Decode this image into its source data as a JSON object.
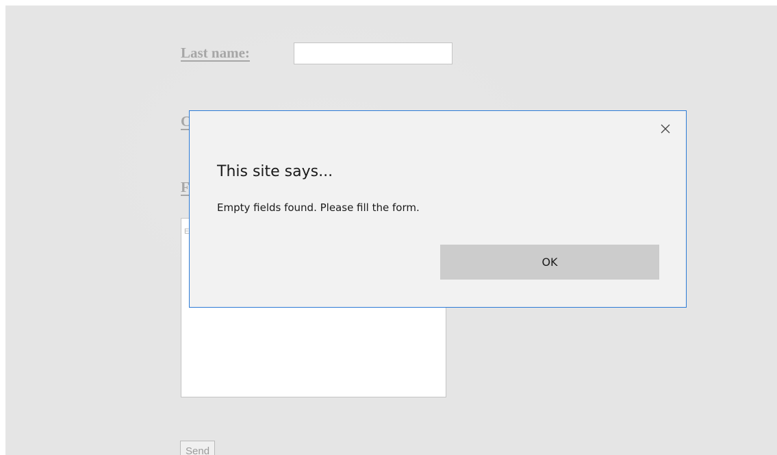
{
  "form": {
    "last_name_label": "Last name:",
    "second_label_partial": "C",
    "third_label_partial": "F",
    "textarea_placeholder": "E",
    "send_label": "Send"
  },
  "dialog": {
    "title": "This site says...",
    "message": "Empty fields found. Please fill the form.",
    "ok_label": "OK",
    "close_icon": "close-icon"
  },
  "colors": {
    "backdrop": "#e5e5e5",
    "dialog_border": "#2b7ad6",
    "dialog_background": "#f2f2f2",
    "ok_button": "#cccccc"
  }
}
